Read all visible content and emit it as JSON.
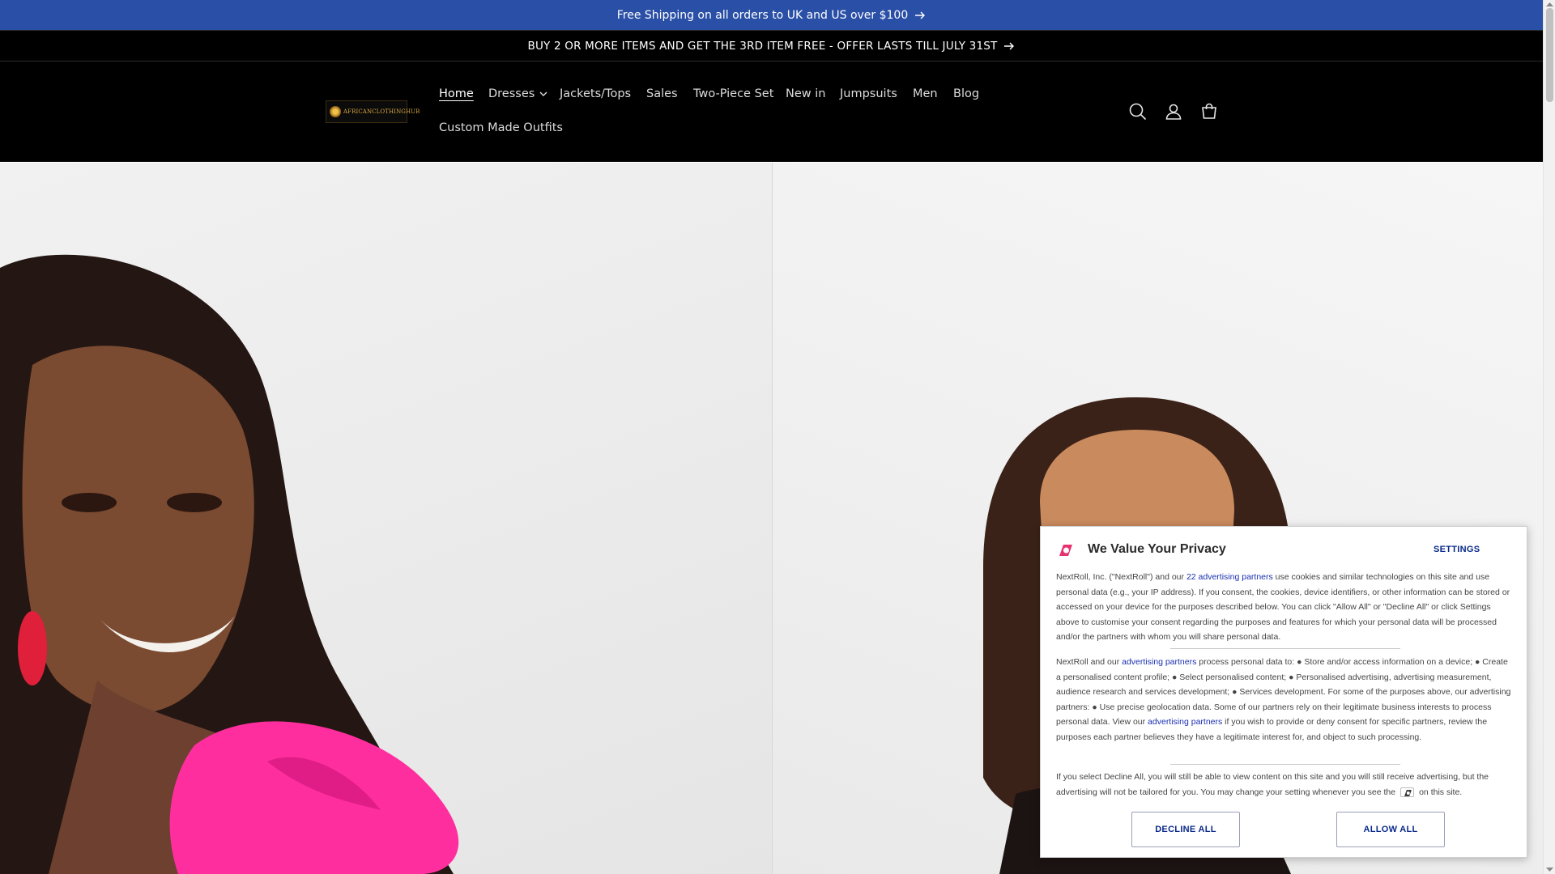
{
  "announcements": {
    "bar1": "Free Shipping on all orders to UK and US over $100",
    "bar2": "BUY 2 OR MORE ITEMS AND GET THE 3RD ITEM FREE - OFFER LASTS TILL JULY 31ST"
  },
  "header": {
    "logo_text": "AFRICANCLOTHINGHUB",
    "nav": [
      {
        "label": "Home",
        "active": true
      },
      {
        "label": "Dresses",
        "has_dropdown": true
      },
      {
        "label": "Jackets/Tops"
      },
      {
        "label": "Sales"
      },
      {
        "label": "Two-Piece Set"
      },
      {
        "label": "New in"
      },
      {
        "label": "Jumpsuits"
      },
      {
        "label": "Men"
      },
      {
        "label": "Blog"
      },
      {
        "label": "Custom Made Outfits"
      }
    ],
    "icons": [
      "search-icon",
      "account-icon",
      "cart-icon"
    ]
  },
  "privacy_modal": {
    "title": "We Value Your Privacy",
    "settings_label": "SETTINGS",
    "p1_a": "NextRoll, Inc. (\"NextRoll\") and our ",
    "p1_link": "22 advertising partners",
    "p1_b": " use cookies and similar technologies on this site and use personal data (e.g., your IP address). If you consent, the cookies, device identifiers, or other information can be stored or accessed on your device for the purposes described below. You can click \"Allow All\" or \"Decline All\" or click Settings above to customise your consent regarding the purposes and features for which your personal data will be processed and/or the partners with whom you will share personal data.",
    "p2_a": "NextRoll and our ",
    "p2_link1": "advertising partners",
    "p2_b": " process personal data to: ● Store and/or access information on a device; ● Create a personalised content profile; ● Select personalised content; ● Personalised advertising, advertising measurement, audience research and services development; ● Services development. For some of the purposes above, our advertising partners: ● Use precise geolocation data. Some of our partners rely on their legitimate business interests to process personal data. View our ",
    "p2_link2": "advertising partners",
    "p2_c": " if you wish to provide or deny consent for specific partners, review the purposes each partner believes they have a legitimate interest for, and object to such processing.",
    "p3_a": "If you select Decline All, you will still be able to view content on this site and you will still receive advertising, but the advertising will not be tailored for you. You may change your setting whenever you see the",
    "p3_b": "on this site.",
    "decline_label": "DECLINE ALL",
    "allow_label": "ALLOW ALL",
    "brand_color": "#e8316f",
    "link_color": "#1a2fb0"
  }
}
